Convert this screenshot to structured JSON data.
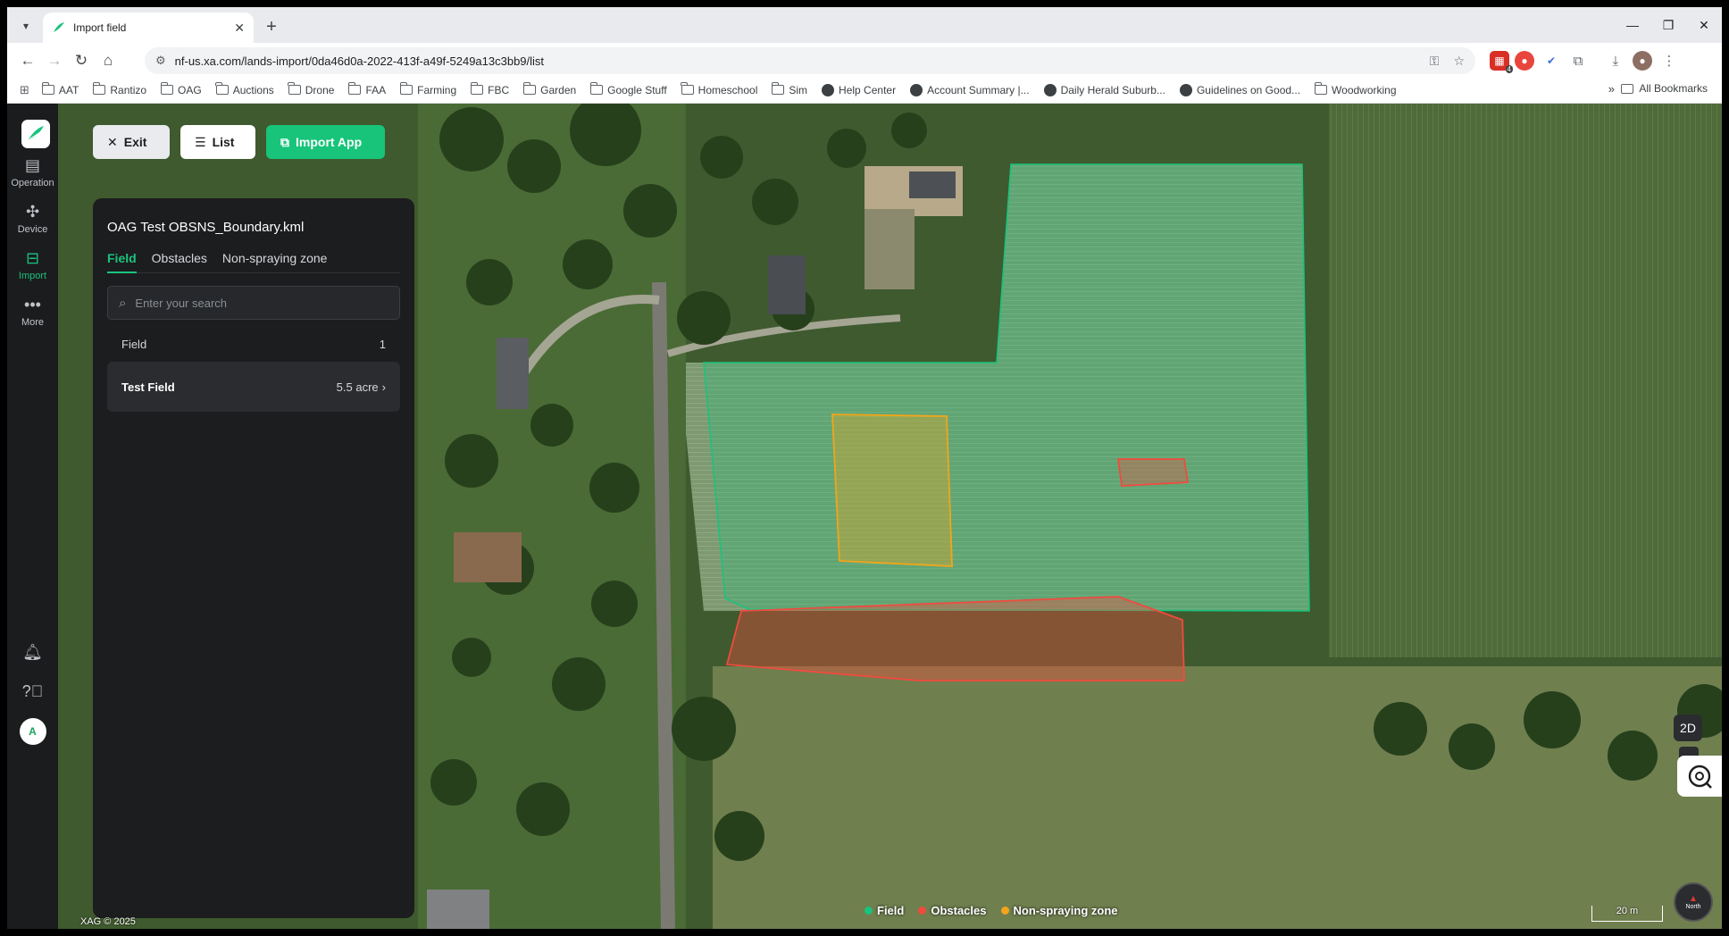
{
  "browser": {
    "tab_title": "Import field",
    "url": "nf-us.xa.com/lands-import/0da46d0a-2022-413f-a49f-5249a13c3bb9/list",
    "extension_badge": "4",
    "bookmarks": [
      {
        "label": "AAT",
        "kind": "folder"
      },
      {
        "label": "Rantizo",
        "kind": "folder"
      },
      {
        "label": "OAG",
        "kind": "folder"
      },
      {
        "label": "Auctions",
        "kind": "folder"
      },
      {
        "label": "Drone",
        "kind": "folder"
      },
      {
        "label": "FAA",
        "kind": "folder"
      },
      {
        "label": "Farming",
        "kind": "folder"
      },
      {
        "label": "FBC",
        "kind": "folder"
      },
      {
        "label": "Garden",
        "kind": "folder"
      },
      {
        "label": "Google Stuff",
        "kind": "folder"
      },
      {
        "label": "Homeschool",
        "kind": "folder"
      },
      {
        "label": "Sim",
        "kind": "folder"
      },
      {
        "label": "Help Center",
        "kind": "site"
      },
      {
        "label": "Account Summary |...",
        "kind": "site"
      },
      {
        "label": "Daily Herald Suburb...",
        "kind": "site"
      },
      {
        "label": "Guidelines on Good...",
        "kind": "site"
      },
      {
        "label": "Woodworking",
        "kind": "folder"
      }
    ],
    "all_bookmarks": "All Bookmarks"
  },
  "rail": {
    "items": [
      {
        "label": "Operation",
        "icon": "clipboard-icon"
      },
      {
        "label": "Device",
        "icon": "drone-icon"
      },
      {
        "label": "Import",
        "icon": "import-icon"
      },
      {
        "label": "More",
        "icon": "more-icon"
      }
    ],
    "active": "Import",
    "avatar": "A"
  },
  "buttons": {
    "exit": "Exit",
    "list": "List",
    "import_app": "Import App"
  },
  "panel": {
    "title": "OAG Test OBSNS_Boundary.kml",
    "tabs": [
      "Field",
      "Obstacles",
      "Non-spraying zone"
    ],
    "active_tab": "Field",
    "search_placeholder": "Enter your search",
    "list_header": "Field",
    "list_count": "1",
    "rows": [
      {
        "name": "Test Field",
        "area": "5.5 acre"
      }
    ]
  },
  "map": {
    "copyright": "XAG © 2025",
    "legend": [
      {
        "label": "Field",
        "color": "#19c37d"
      },
      {
        "label": "Obstacles",
        "color": "#ef4b3f"
      },
      {
        "label": "Non-spraying zone",
        "color": "#f2a51a"
      }
    ],
    "view_mode": "2D",
    "compass_label": "North",
    "scale_label": "20 m"
  }
}
